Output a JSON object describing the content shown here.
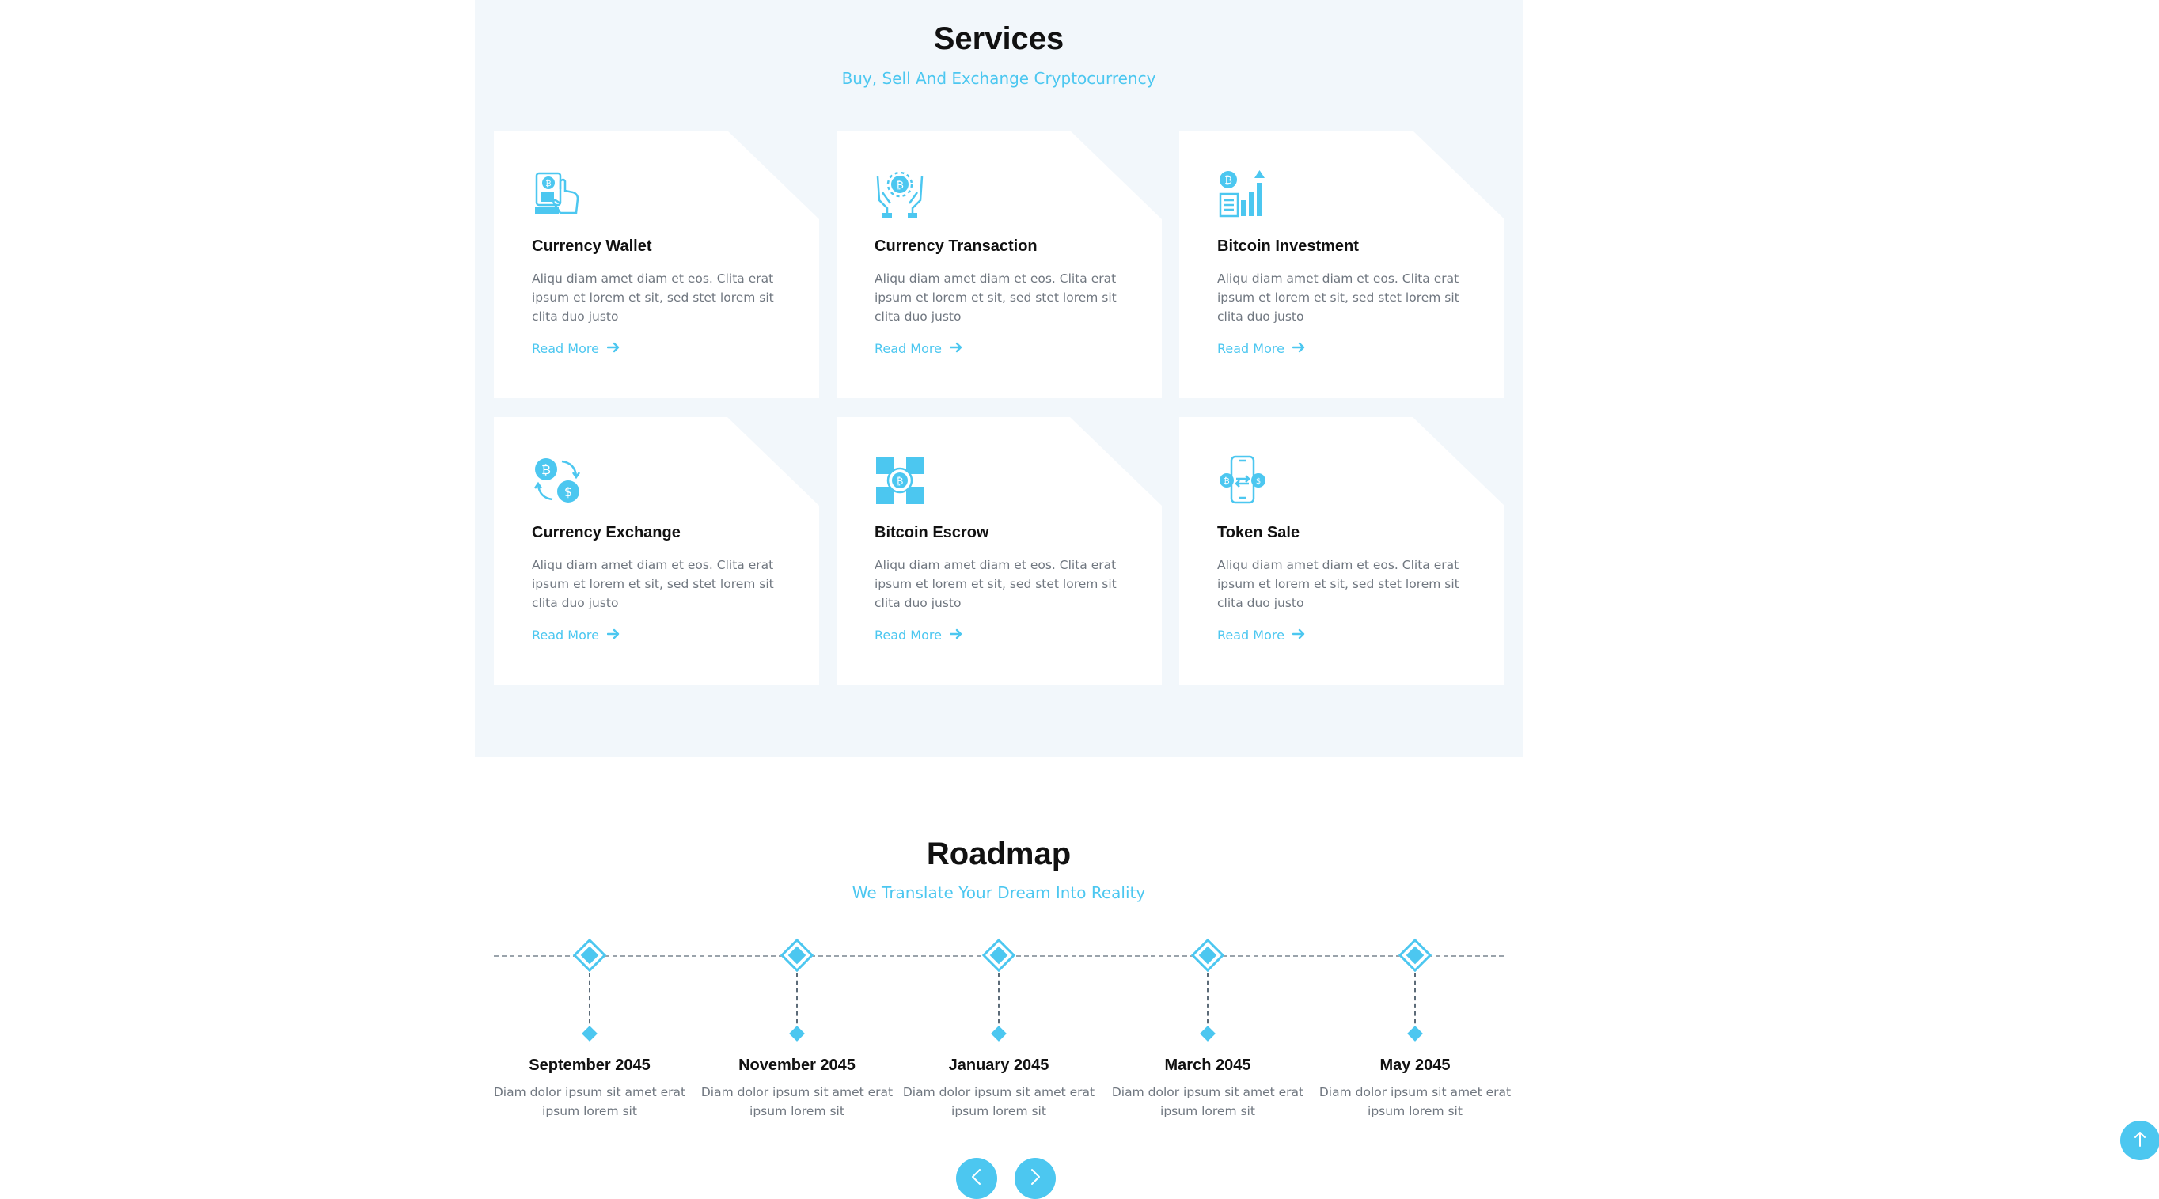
{
  "services": {
    "title": "Services",
    "subtitle": "Buy, Sell And Exchange Cryptocurrency",
    "cards": [
      {
        "title": "Currency Wallet",
        "text": "Aliqu diam amet diam et eos. Clita erat ipsum et lorem et sit, sed stet lorem sit clita duo justo",
        "link": "Read More",
        "icon": "wallet-hand-icon"
      },
      {
        "title": "Currency Transaction",
        "text": "Aliqu diam amet diam et eos. Clita erat ipsum et lorem et sit, sed stet lorem sit clita duo justo",
        "link": "Read More",
        "icon": "hands-coin-icon"
      },
      {
        "title": "Bitcoin Investment",
        "text": "Aliqu diam amet diam et eos. Clita erat ipsum et lorem et sit, sed stet lorem sit clita duo justo",
        "link": "Read More",
        "icon": "growth-chart-icon"
      },
      {
        "title": "Currency Exchange",
        "text": "Aliqu diam amet diam et eos. Clita erat ipsum et lorem et sit, sed stet lorem sit clita duo justo",
        "link": "Read More",
        "icon": "exchange-icon"
      },
      {
        "title": "Bitcoin Escrow",
        "text": "Aliqu diam amet diam et eos. Clita erat ipsum et lorem et sit, sed stet lorem sit clita duo justo",
        "link": "Read More",
        "icon": "escrow-icon"
      },
      {
        "title": "Token Sale",
        "text": "Aliqu diam amet diam et eos. Clita erat ipsum et lorem et sit, sed stet lorem sit clita duo justo",
        "link": "Read More",
        "icon": "mobile-token-icon"
      }
    ]
  },
  "roadmap": {
    "title": "Roadmap",
    "subtitle": "We Translate Your Dream Into Reality",
    "milestones": [
      {
        "date": "September 2045",
        "text": "Diam dolor ipsum sit amet erat ipsum lorem sit"
      },
      {
        "date": "November 2045",
        "text": "Diam dolor ipsum sit amet erat ipsum lorem sit"
      },
      {
        "date": "January 2045",
        "text": "Diam dolor ipsum sit amet erat ipsum lorem sit"
      },
      {
        "date": "March 2045",
        "text": "Diam dolor ipsum sit amet erat ipsum lorem sit"
      },
      {
        "date": "May 2045",
        "text": "Diam dolor ipsum sit amet erat ipsum lorem sit"
      }
    ]
  },
  "colors": {
    "accent": "#4cc7f0",
    "section_bg": "#f2f7fb",
    "heading": "#111111",
    "body_text": "#707780"
  }
}
